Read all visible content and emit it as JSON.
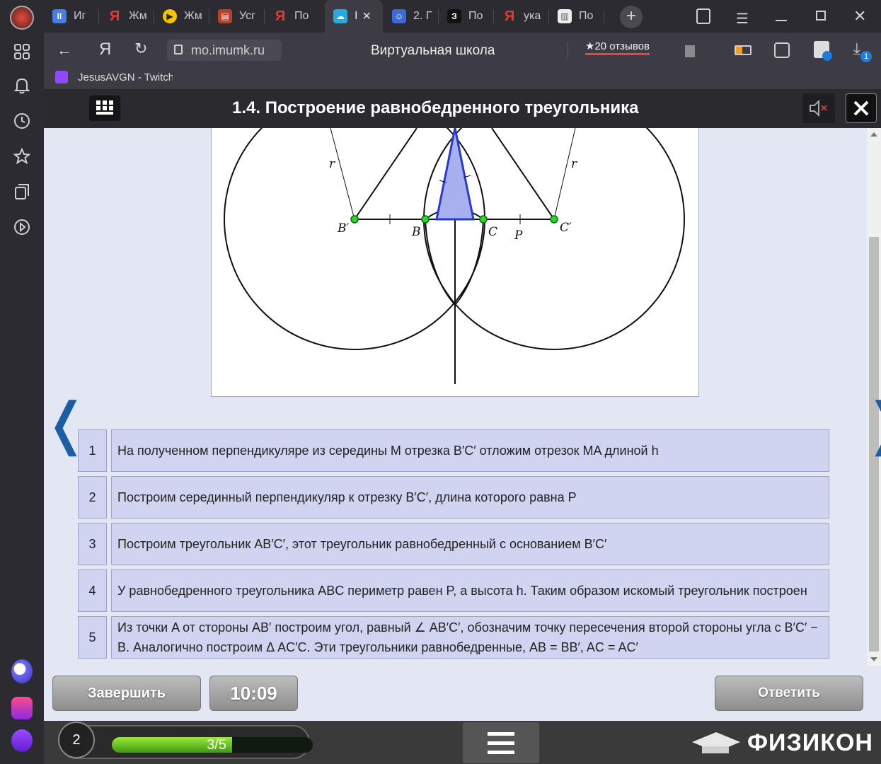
{
  "browser": {
    "tabs": [
      {
        "label": "Иг",
        "icon": "pause-icon",
        "color": "#4a7de2"
      },
      {
        "label": "Жм",
        "icon": "yandex-icon",
        "color": "#e53935"
      },
      {
        "label": "Жм",
        "icon": "play-icon",
        "color": "#f7c400"
      },
      {
        "label": "Усг",
        "icon": "book-icon",
        "color": "#b7412e"
      },
      {
        "label": "По",
        "icon": "yandex-icon",
        "color": "#e53935"
      },
      {
        "label": "I",
        "icon": "game-icon",
        "color": "#2aa8d9"
      },
      {
        "label": "2. Г",
        "icon": "owl-icon",
        "color": "#3d6ad6"
      },
      {
        "label": "По",
        "icon": "z-icon",
        "color": "#111111"
      },
      {
        "label": "ука",
        "icon": "yandex-icon",
        "color": "#e53935"
      },
      {
        "label": "По",
        "icon": "doc-icon",
        "color": "#eeeeee"
      }
    ],
    "url": "mo.imumk.ru",
    "page_title": "Виртуальная школа",
    "reviews": "★20 отзывов",
    "download_badge": "1",
    "bookmark": "JesusAVGN - Twitch"
  },
  "lesson": {
    "title": "1.4. Построение равнобедренного треугольника",
    "figure_labels": {
      "r_left": "r",
      "r_right": "r",
      "b_prime": "B′",
      "b": "B",
      "c": "C",
      "p": "P",
      "c_prime": "C′"
    },
    "rows": [
      {
        "num": "1",
        "text": "На полученном перпендикуляре из середины M отрезка B′C′ отложим отрезок MA длиной h"
      },
      {
        "num": "2",
        "text": "Построим серединный перпендикуляр к отрезку B′C′, длина которого равна P"
      },
      {
        "num": "3",
        "text": "Построим треугольник AB′C′, этот треугольник равнобедренный с основанием B′C′"
      },
      {
        "num": "4",
        "text": "У равнобедренного треугольника ABC периметр равен P, а высота h. Таким образом искомый треугольник построен"
      },
      {
        "num": "5",
        "text": "Из точки A от стороны AB′ построим угол, равный ∠ AB′C′, обозначим точку пересечения второй стороны угла с B′C′ − B. Аналогично построим Δ AC′C. Эти треугольники равнобедренные, AB = BB′, AC = AC′"
      }
    ],
    "finish_label": "Завершить",
    "timer": "10:09",
    "answer_label": "Ответить"
  },
  "footer": {
    "level": "2",
    "progress_text": "3/5",
    "progress_fraction": 0.6,
    "brand": "ФИЗИКОН"
  }
}
